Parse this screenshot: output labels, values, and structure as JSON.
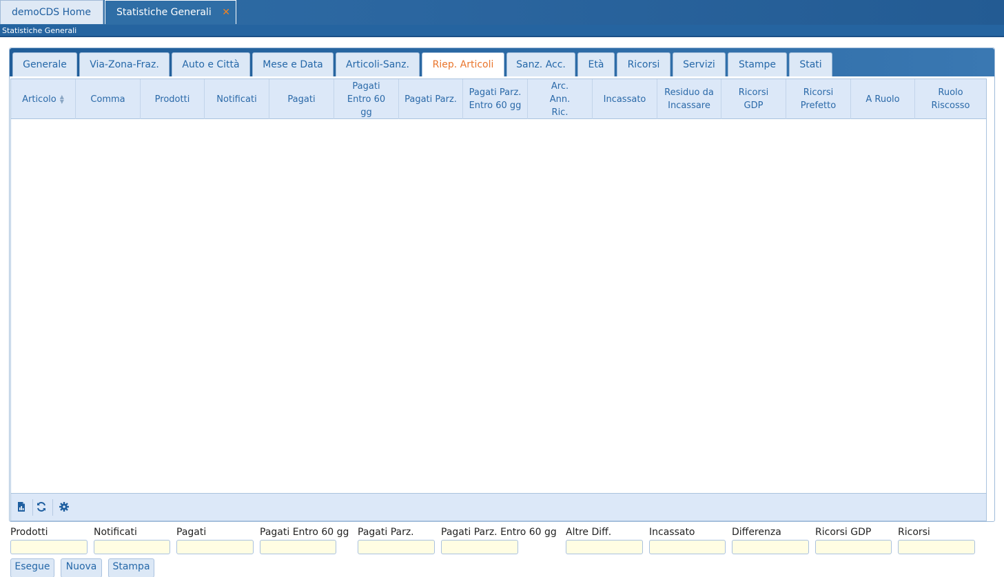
{
  "window_tabs": {
    "home": "demoCDS Home",
    "active": "Statistiche Generali",
    "close_symbol": "✕"
  },
  "breadcrumb": "Statistiche Generali",
  "tabs": [
    {
      "label": "Generale"
    },
    {
      "label": "Via-Zona-Fraz."
    },
    {
      "label": "Auto e Città"
    },
    {
      "label": "Mese e Data"
    },
    {
      "label": "Articoli-Sanz."
    },
    {
      "label": "Riep. Articoli"
    },
    {
      "label": "Sanz. Acc."
    },
    {
      "label": "Età"
    },
    {
      "label": "Ricorsi"
    },
    {
      "label": "Servizi"
    },
    {
      "label": "Stampe"
    },
    {
      "label": "Stati"
    }
  ],
  "active_tab": "Riep. Articoli",
  "grid": {
    "columns": [
      "Articolo",
      "Comma",
      "Prodotti",
      "Notificati",
      "Pagati",
      "Pagati Entro 60 gg",
      "Pagati Parz.",
      "Pagati Parz. Entro 60 gg",
      "Arc. Ann. Ric.",
      "Incassato",
      "Residuo da Incassare",
      "Ricorsi GDP",
      "Ricorsi Prefetto",
      "A Ruolo",
      "Ruolo Riscosso"
    ],
    "sorted_column": "Articolo",
    "rows": []
  },
  "footer_icons": [
    "export-excel-icon",
    "refresh-icon",
    "settings-icon"
  ],
  "summary": {
    "fields": [
      {
        "label": "Prodotti",
        "value": ""
      },
      {
        "label": "Notificati",
        "value": ""
      },
      {
        "label": "Pagati",
        "value": ""
      },
      {
        "label": "Pagati Entro 60 gg",
        "value": ""
      },
      {
        "label": "Pagati Parz.",
        "value": ""
      },
      {
        "label": "Pagati Parz. Entro 60 gg",
        "value": ""
      },
      {
        "label": "Altre Diff.",
        "value": ""
      },
      {
        "label": "Incassato",
        "value": ""
      },
      {
        "label": "Differenza",
        "value": ""
      },
      {
        "label": "Ricorsi GDP",
        "value": ""
      },
      {
        "label": "Ricorsi",
        "value": ""
      }
    ]
  },
  "buttons": {
    "esegue": "Esegue",
    "nuova": "Nuova",
    "stampa": "Stampa"
  },
  "colors": {
    "header_blue": "#2f6ea6",
    "link_blue": "#2467a8",
    "active_tab_orange": "#e9742a",
    "input_bg": "#fffde3"
  }
}
